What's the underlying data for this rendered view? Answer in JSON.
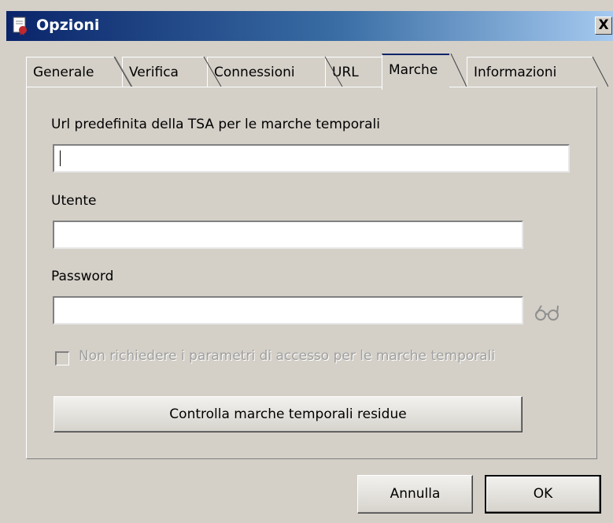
{
  "window": {
    "title": "Opzioni",
    "close_label": "X"
  },
  "tabs": [
    {
      "label": "Generale"
    },
    {
      "label": "Verifica"
    },
    {
      "label": "Connessioni"
    },
    {
      "label": "URL"
    },
    {
      "label": "Marche",
      "active": true
    },
    {
      "label": "Informazioni"
    }
  ],
  "form": {
    "tsa_url_label": "Url predefinita della TSA per le marche temporali",
    "tsa_url_value": "",
    "user_label": "Utente",
    "user_value": "",
    "password_label": "Password",
    "password_value": "",
    "no_access_params_label": "Non richiedere i parametri di accesso per le marche temporali",
    "no_access_params_checked": false,
    "check_button_label": "Controlla marche temporali residue"
  },
  "footer": {
    "cancel_label": "Annulla",
    "ok_label": "OK"
  },
  "icons": {
    "title_icon": "document-seal-icon",
    "show_password_icon": "glasses-icon"
  },
  "colors": {
    "titlebar_start": "#0a246a",
    "titlebar_end": "#a6caf0",
    "face": "#d4d0c8"
  }
}
